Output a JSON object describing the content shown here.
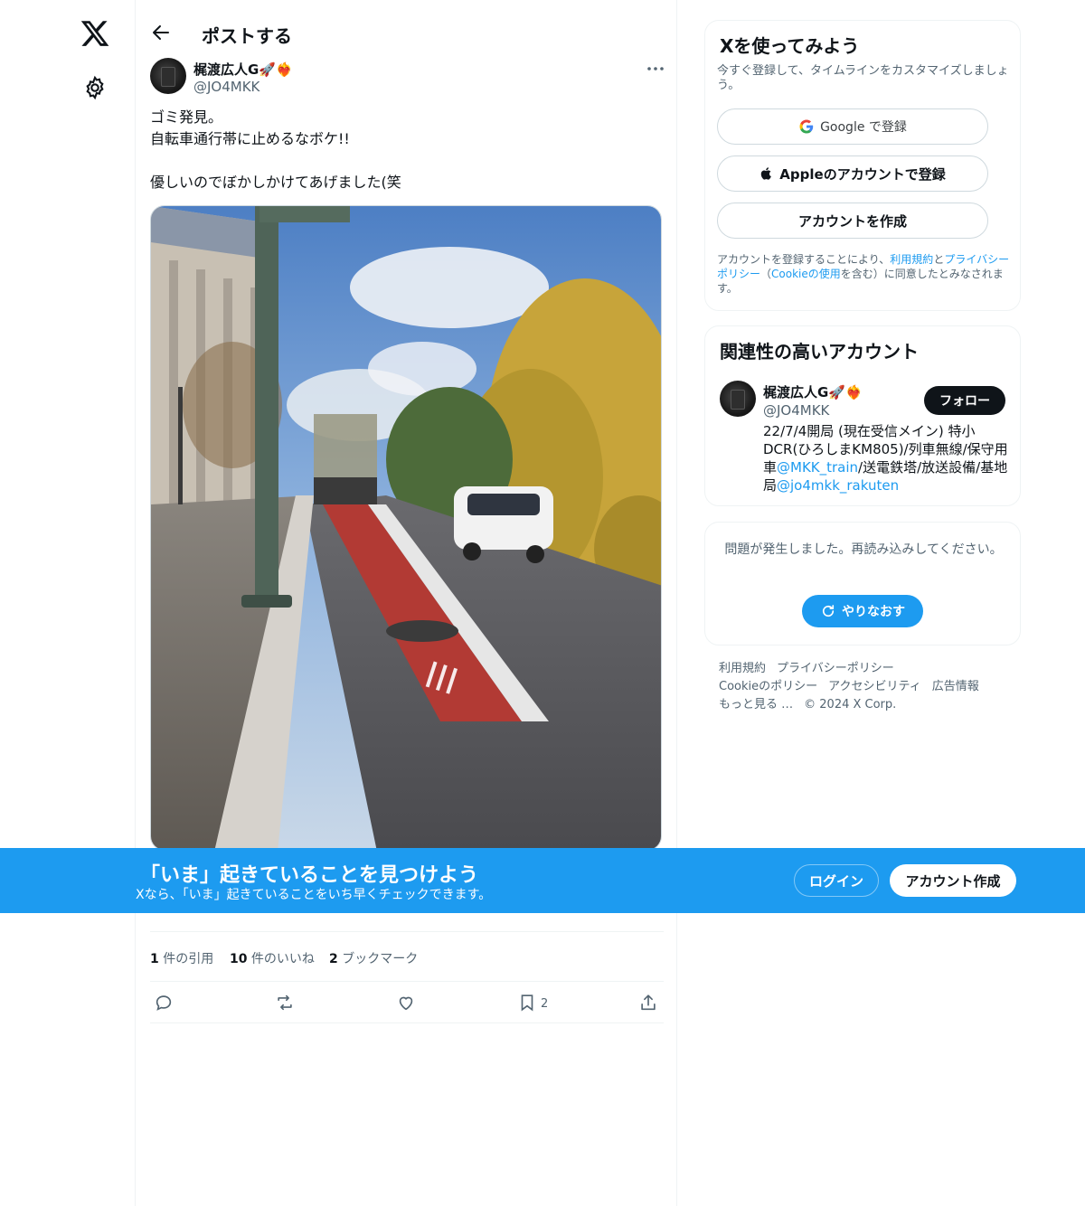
{
  "colors": {
    "accent": "#1d9bf0",
    "text": "#0f1419",
    "muted": "#536471",
    "border": "#eff3f4"
  },
  "nav": {
    "logo_icon": "x-logo-icon",
    "settings_icon": "gear-icon"
  },
  "header": {
    "title": "ポストする",
    "back_icon": "arrow-left-icon"
  },
  "post": {
    "author_name": "梶渡広人G🚀❤️‍🔥",
    "author_handle": "@JO4MKK",
    "text": "ゴミ発見。\n自転車通行帯に止めるなボケ!!\n\n優しいのでぼかしかけてあげました(笑",
    "stats": {
      "quotes_count": "1",
      "quotes_label": " 件の引用",
      "likes_count": "10",
      "likes_label": " 件のいいね",
      "bookmarks_count": "2",
      "bookmarks_label": " ブックマーク"
    },
    "bookmark_count": "2"
  },
  "sidebar": {
    "signup": {
      "title": "Xを使ってみよう",
      "subtitle": "今すぐ登録して、タイムラインをカスタマイズしましょう。",
      "google_label": "Google で登録",
      "apple_label": "Appleのアカウントで登録",
      "create_label": "アカウントを作成",
      "legal_prefix": "アカウントを登録することにより、",
      "legal_terms": "利用規約",
      "legal_and": "と",
      "legal_privacy": "プライバシーポリシー",
      "legal_paren_open": "（",
      "legal_cookie": "Cookieの使用",
      "legal_suffix": "を含む）に同意したとみなされます。"
    },
    "related": {
      "title": "関連性の高いアカウント",
      "name": "梶渡広人G🚀❤️‍🔥",
      "handle": "@JO4MKK",
      "follow_label": "フォロー",
      "bio_part1": "22/7/4開局 (現在受信メイン) 特小DCR(ひろしまKM805)/列車無線/保守用車",
      "bio_link1": "@MKK_train",
      "bio_part2": "/送電鉄塔/放送設備/基地局",
      "bio_link2": "@jo4mkk_rakuten"
    },
    "error": {
      "message": "問題が発生しました。再読み込みしてください。",
      "retry_label": "やりなおす"
    },
    "footer": {
      "terms": "利用規約",
      "privacy": "プライバシーポリシー",
      "cookie": "Cookieのポリシー",
      "accessibility": "アクセシビリティ",
      "ads": "広告情報",
      "more": "もっと見る …",
      "copyright": "© 2024 X Corp."
    }
  },
  "banner": {
    "title": "「いま」起きていることを見つけよう",
    "subtitle": "Xなら、「いま」起きていることをいち早くチェックできます。",
    "login_label": "ログイン",
    "create_label": "アカウント作成"
  }
}
